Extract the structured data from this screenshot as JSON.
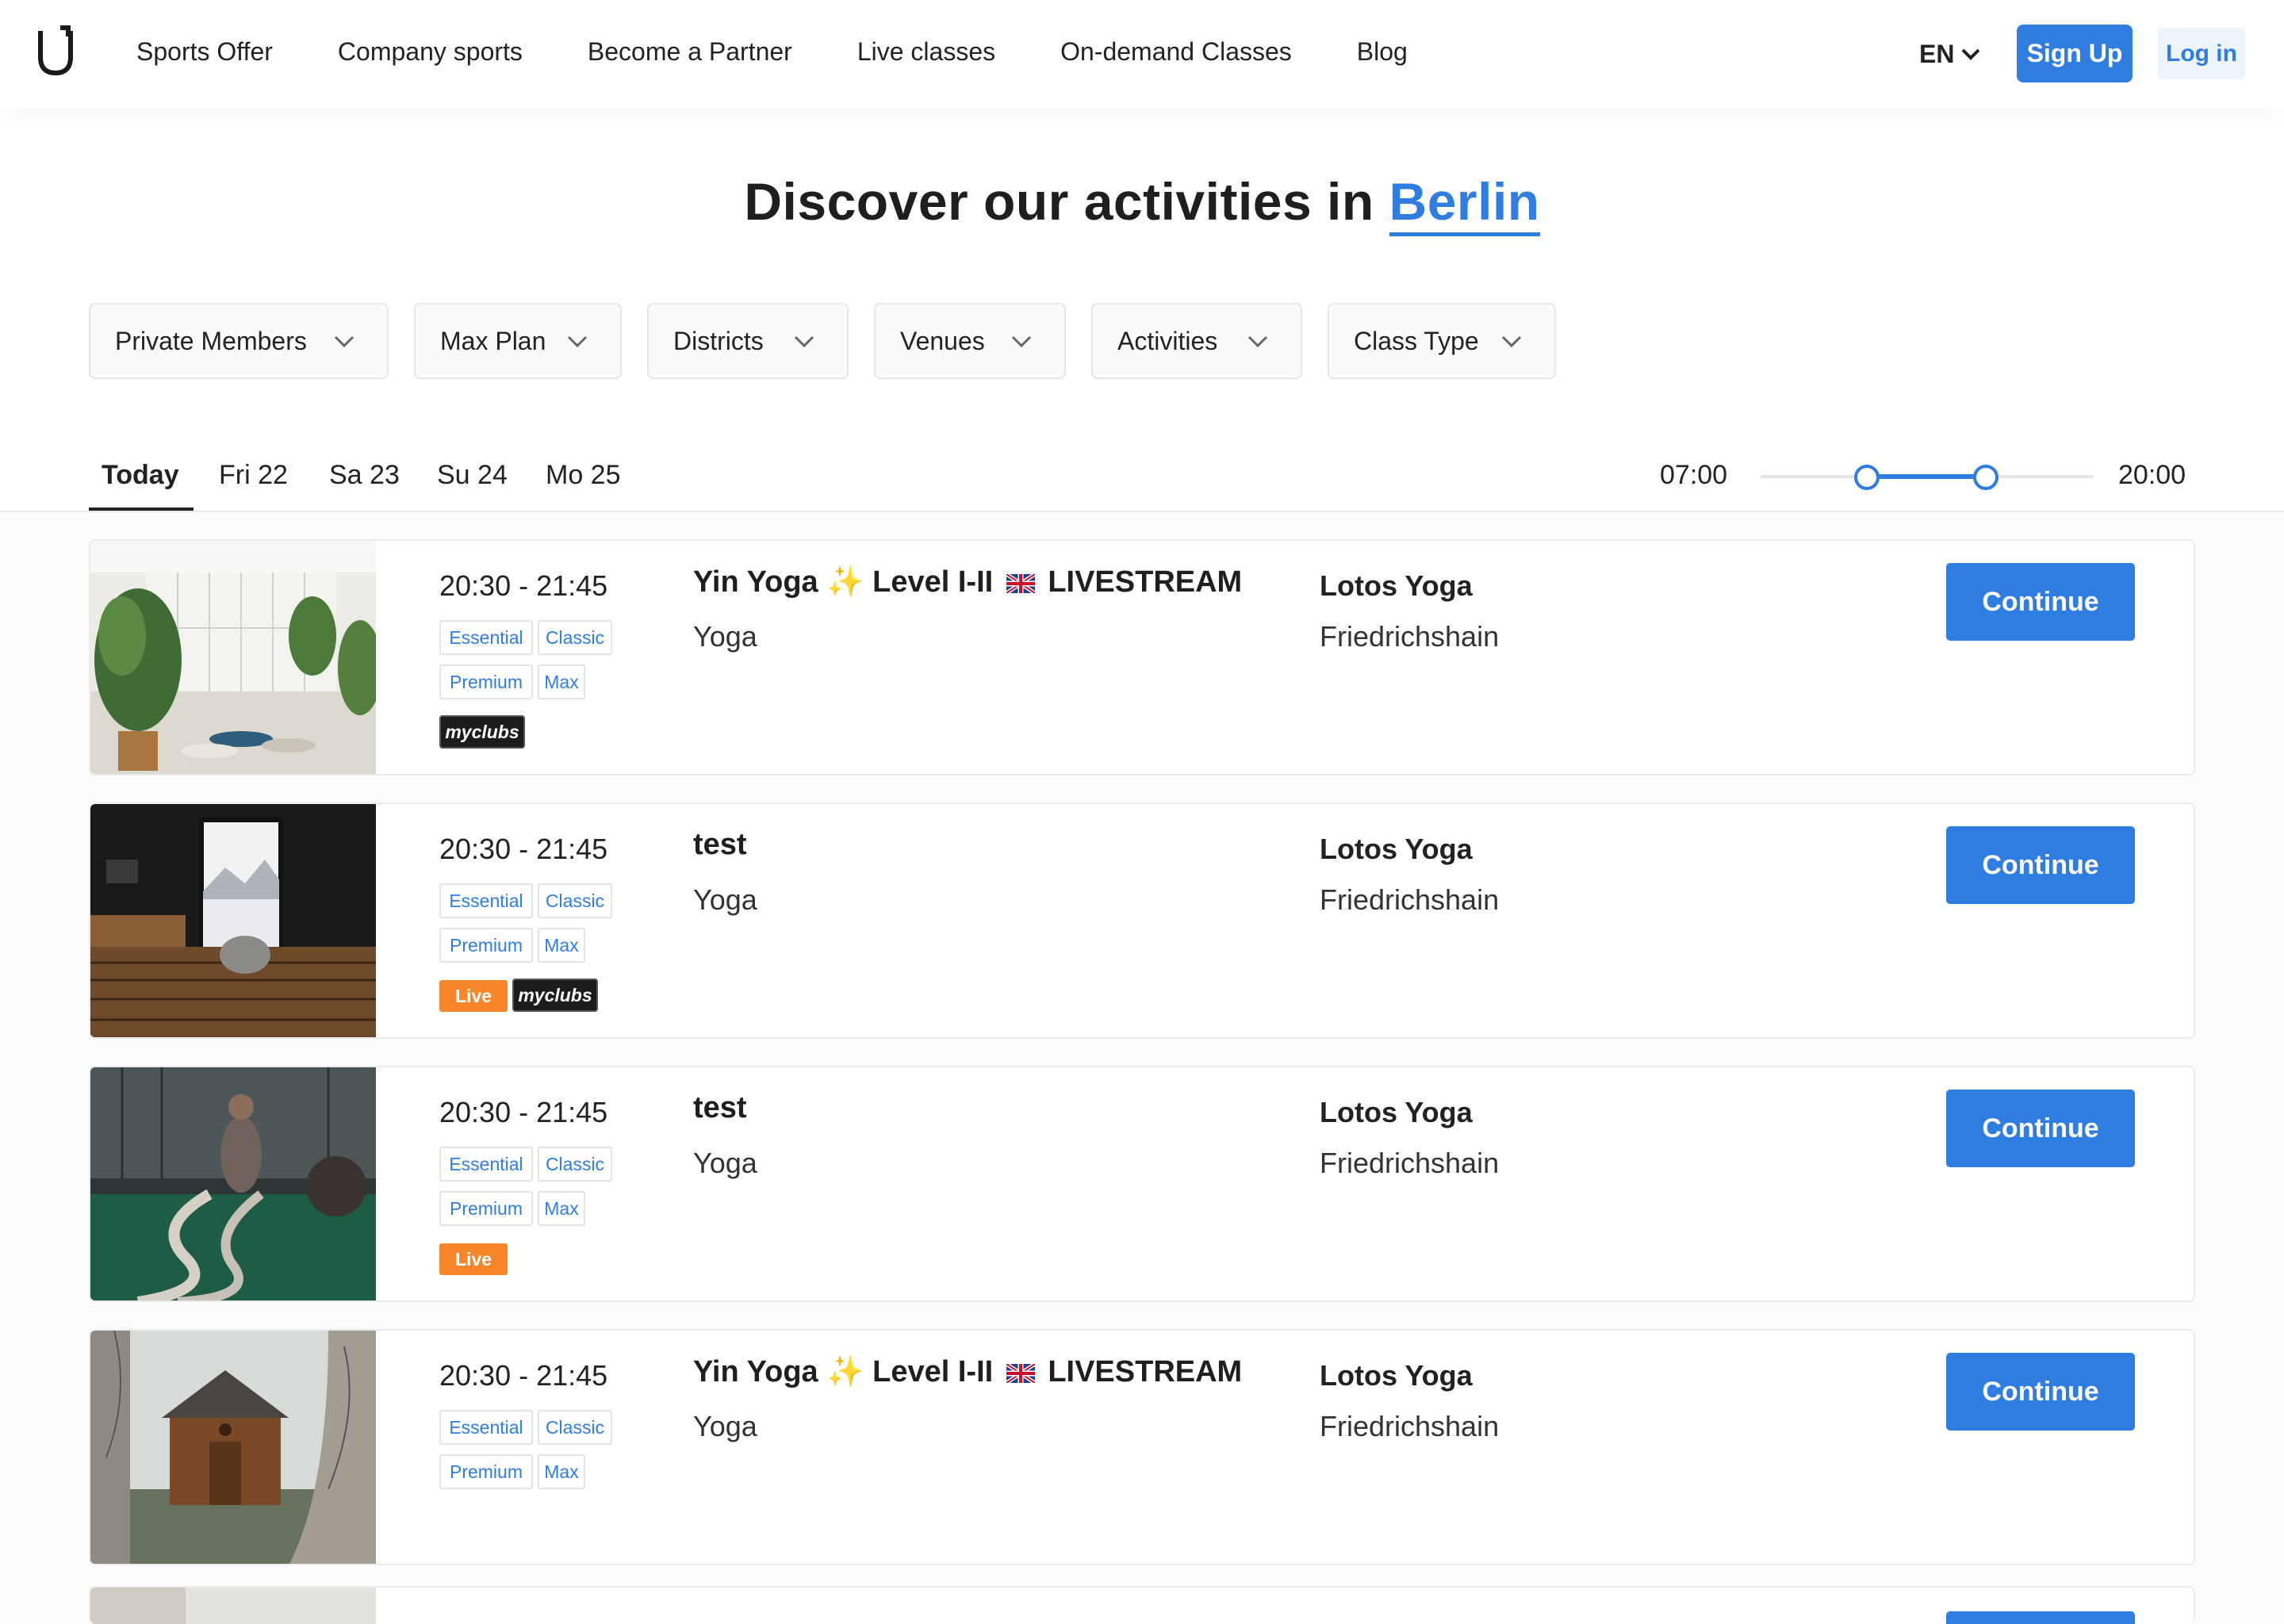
{
  "nav": {
    "links": [
      "Sports Offer",
      "Company sports",
      "Become a Partner",
      "Live classes",
      "On-demand Classes",
      "Blog"
    ],
    "language": "EN",
    "signup_label": "Sign Up",
    "login_label": "Log in"
  },
  "header": {
    "title_prefix": "Discover our activities in",
    "city": "Berlin"
  },
  "filters": [
    "Private Members",
    "Max Plan",
    "Districts",
    "Venues",
    "Activities",
    "Class Type"
  ],
  "dates": {
    "tabs": [
      "Today",
      "Fri 22",
      "Sa 23",
      "Su 24",
      "Mo 25"
    ],
    "active": "Today"
  },
  "time_range": {
    "min_label": "07:00",
    "max_label": "20:00"
  },
  "plan_tags": [
    "Essential",
    "Classic",
    "Premium",
    "Max"
  ],
  "badges": {
    "live": "Live",
    "myclubs": "myclubs"
  },
  "continue_label": "Continue",
  "classes": [
    {
      "time": "20:30 - 21:45",
      "title_parts": [
        "Yin Yoga",
        "✨",
        "Level I-II",
        "LIVESTREAM"
      ],
      "category": "Yoga",
      "venue": "Lotos Yoga",
      "district": "Friedrichshain",
      "live": false,
      "myclubs": true,
      "image": "yoga-studio-photo"
    },
    {
      "time": "20:30 - 21:45",
      "title": "test",
      "category": "Yoga",
      "venue": "Lotos Yoga",
      "district": "Friedrichshain",
      "live": true,
      "myclubs": true,
      "image": "sauna-photo"
    },
    {
      "time": "20:30 - 21:45",
      "title": "test",
      "category": "Yoga",
      "venue": "Lotos Yoga",
      "district": "Friedrichshain",
      "live": true,
      "myclubs": false,
      "image": "battle-rope-gym-photo"
    },
    {
      "time": "20:30 - 21:45",
      "title_parts": [
        "Yin Yoga",
        "✨",
        "Level I-II",
        "LIVESTREAM"
      ],
      "category": "Yoga",
      "venue": "Lotos Yoga",
      "district": "Friedrichshain",
      "live": false,
      "myclubs": false,
      "image": "wooden-hut-photo"
    }
  ],
  "colors": {
    "accent": "#2f7de1",
    "live": "#f7862a",
    "myclubs": "#1c1c1c"
  }
}
